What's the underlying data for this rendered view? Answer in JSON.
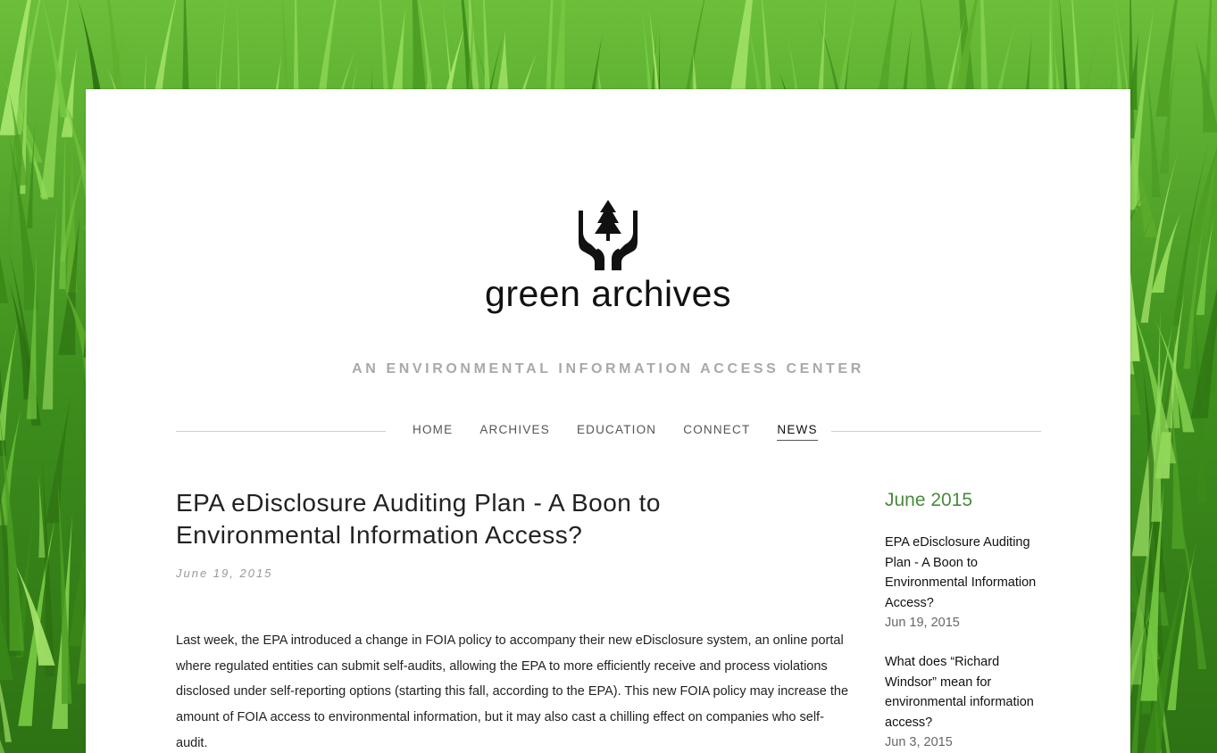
{
  "site": {
    "title": "green archives",
    "tagline": "AN ENVIRONMENTAL INFORMATION ACCESS CENTER"
  },
  "nav": {
    "items": [
      {
        "label": "HOME",
        "active": false
      },
      {
        "label": "ARCHIVES",
        "active": false
      },
      {
        "label": "EDUCATION",
        "active": false
      },
      {
        "label": "CONNECT",
        "active": false
      },
      {
        "label": "NEWS",
        "active": true
      }
    ]
  },
  "post": {
    "title": "EPA eDisclosure Auditing Plan - A Boon to Environmental Information Access?",
    "date": "June 19, 2015",
    "body": "Last week, the EPA introduced a change in FOIA policy to accompany their new eDisclosure system, an online portal where regulated entities can submit self-audits, allowing the EPA to more efficiently receive and process violations disclosed under self-reporting options (starting this fall, according to the EPA). This new FOIA policy may increase the amount of FOIA access to environmental information, but it may also cast a chilling effect on companies who self-audit."
  },
  "sidebar": {
    "month": "June 2015",
    "posts": [
      {
        "title": "EPA eDisclosure Auditing Plan - A Boon to Environmental Information Access?",
        "date": "Jun 19, 2015"
      },
      {
        "title": "What does “Richard Windsor” mean for environmental information access?",
        "date": "Jun 3, 2015"
      }
    ]
  },
  "colors": {
    "accent": "#4a8a3c",
    "background_grass": "#3f8c1e"
  },
  "icons": {
    "logo": "hands-holding-tree-icon"
  }
}
